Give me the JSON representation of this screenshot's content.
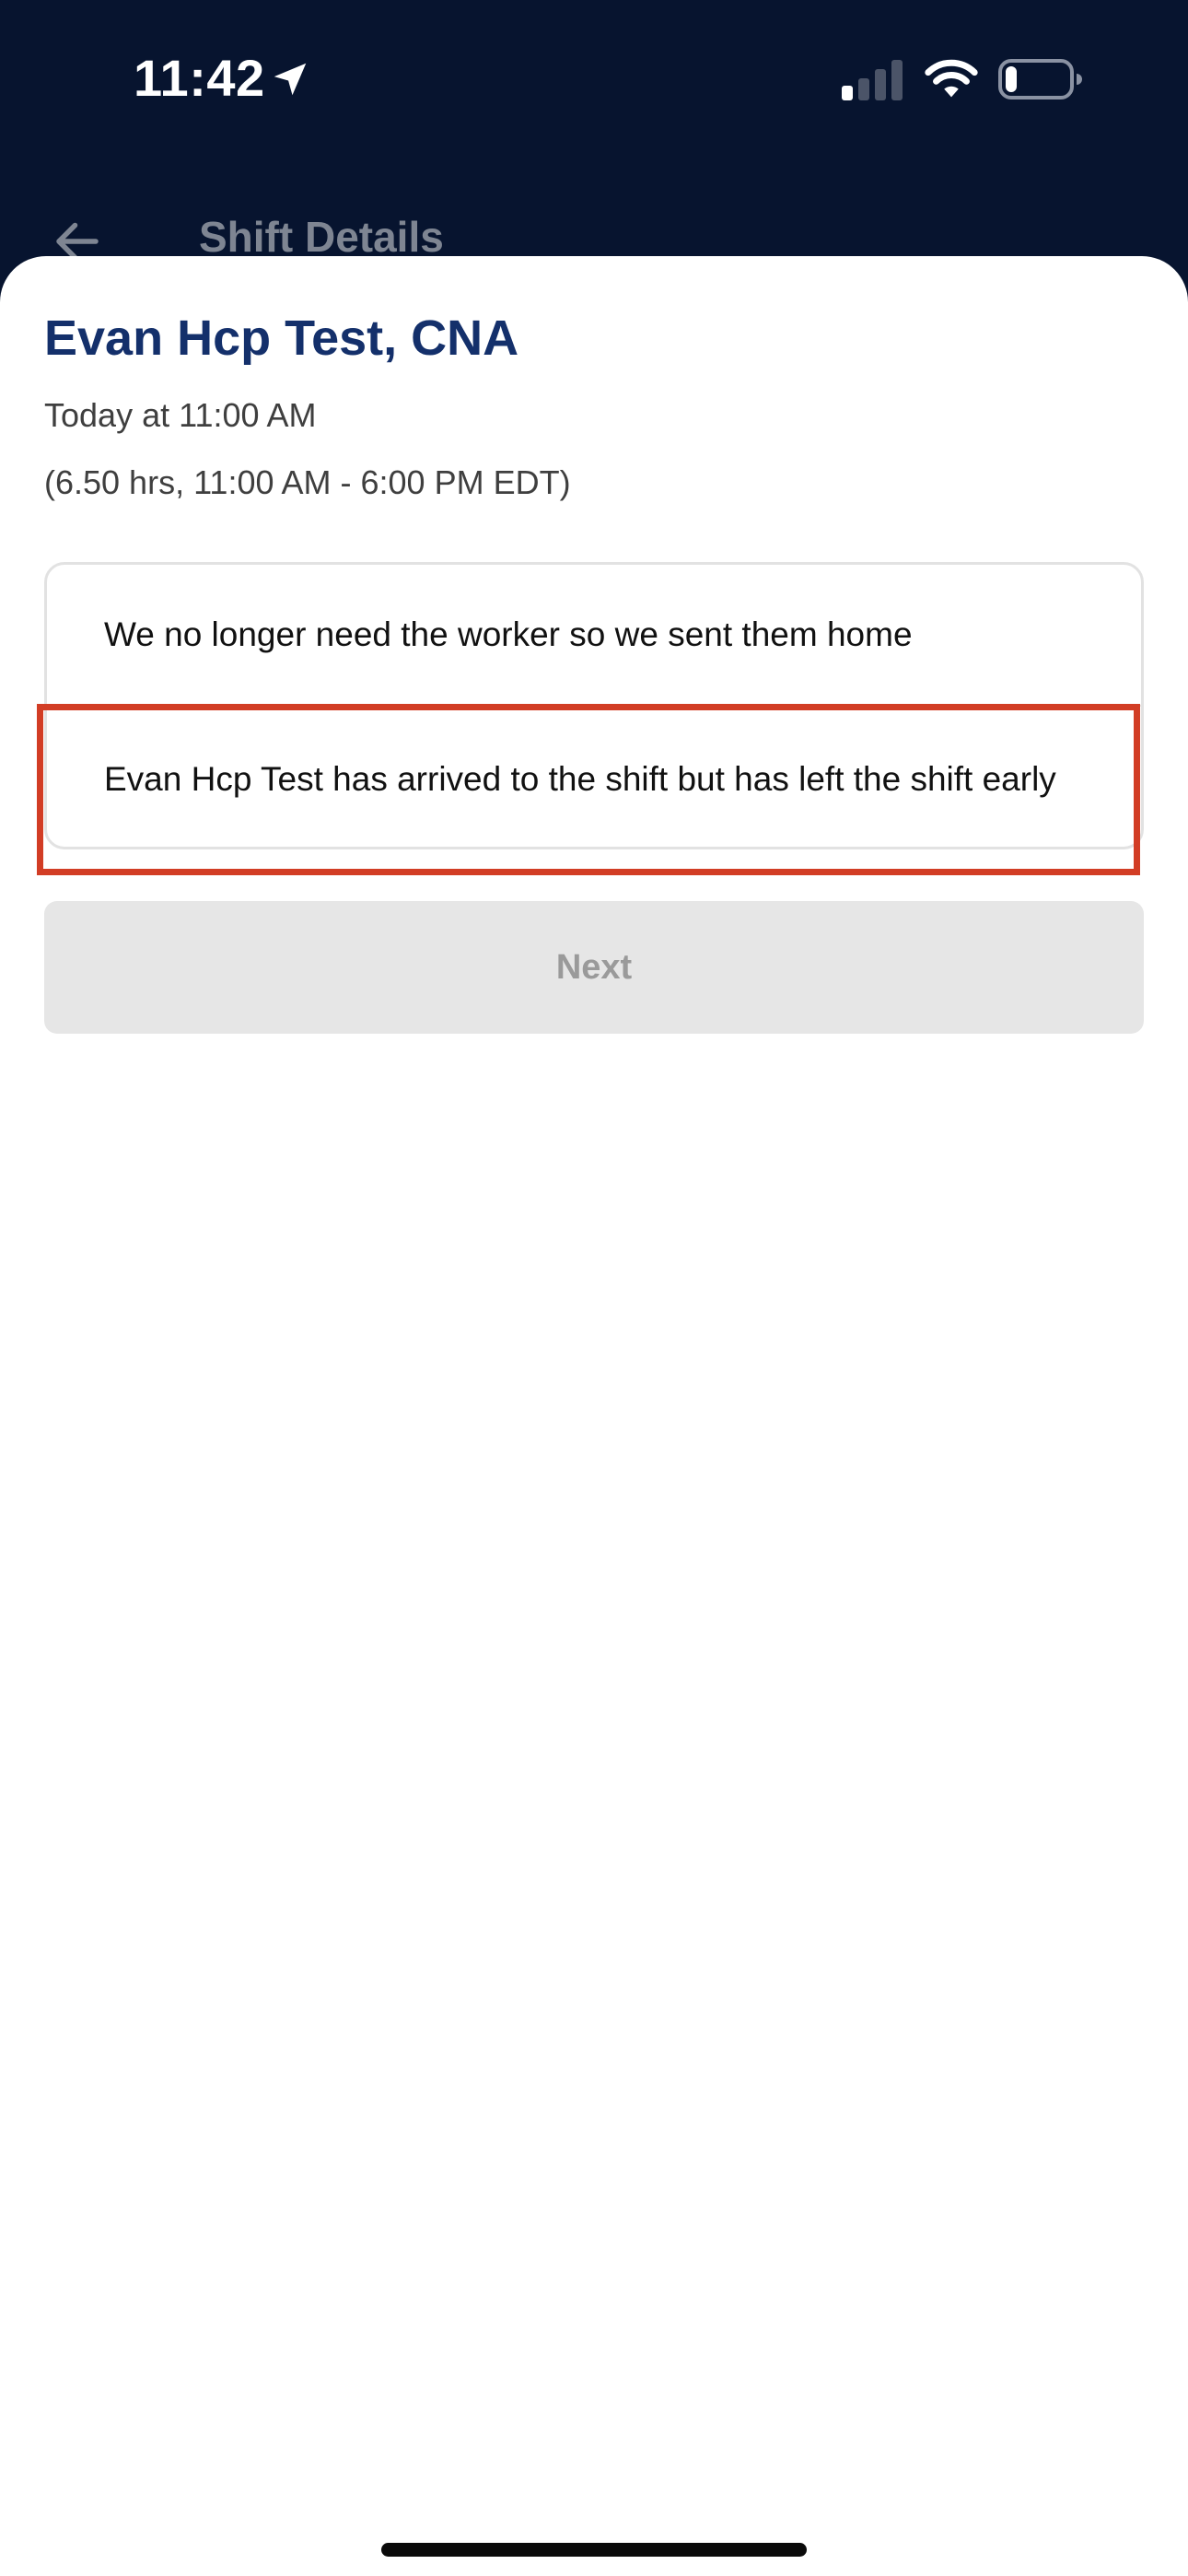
{
  "status_bar": {
    "time": "11:42",
    "icons": [
      "location-arrow-icon",
      "cellular-signal-icon",
      "wifi-icon",
      "battery-icon"
    ]
  },
  "header": {
    "title": "Shift Details",
    "back_icon": "arrow-left-icon"
  },
  "shift": {
    "worker_name": "Evan Hcp Test, CNA",
    "date_line": "Today at 11:00 AM",
    "hours_line": "(6.50 hrs, 11:00 AM - 6:00 PM EDT)"
  },
  "options": [
    {
      "label": "We no longer need the worker so we sent them home"
    },
    {
      "label": "Evan Hcp Test has arrived to the shift but has left the shift early"
    }
  ],
  "next_button": {
    "label": "Next",
    "enabled": false
  },
  "colors": {
    "header_bg": "#07142f",
    "title_blue": "#14306b",
    "highlight_red": "#d23d25",
    "button_disabled_bg": "#e6e6e6",
    "button_disabled_text": "#9a9a9a"
  }
}
